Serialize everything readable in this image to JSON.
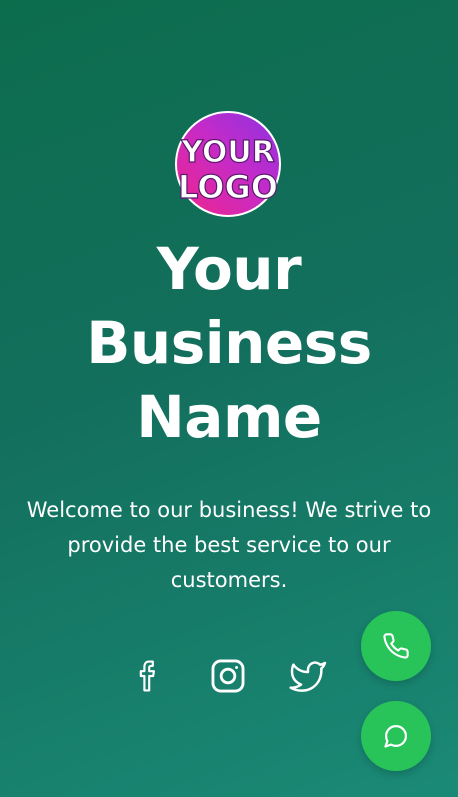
{
  "header": {
    "logo_text": [
      "YOUR",
      "LOGO"
    ],
    "business_name_lines": [
      "Your",
      "Business",
      "Name"
    ],
    "tagline": "Welcome to our business! We strive to provide the best service to our customers."
  },
  "social": {
    "items": [
      {
        "icon": "facebook-icon"
      },
      {
        "icon": "instagram-icon"
      },
      {
        "icon": "twitter-icon"
      }
    ]
  },
  "floating_actions": {
    "phone": {
      "icon": "phone-icon"
    },
    "chat": {
      "icon": "whatsapp-icon"
    }
  },
  "colors": {
    "background_start": "#0c6d4d",
    "background_end": "#1a8a76",
    "fab_green": "#28c45a",
    "logo_pink": "#e6248a",
    "logo_purple": "#8b2ad9"
  }
}
